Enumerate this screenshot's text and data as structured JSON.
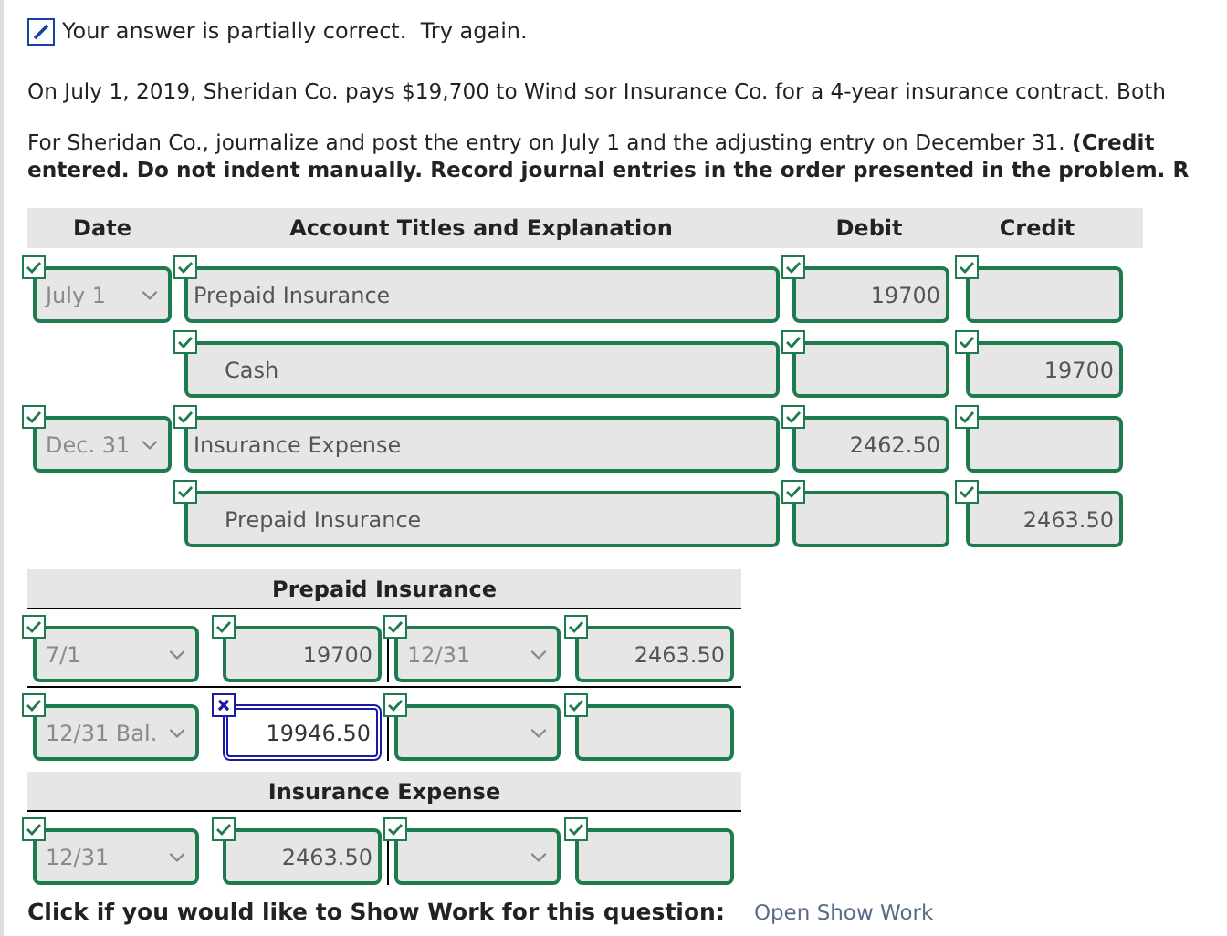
{
  "feedback": {
    "kind": "partial",
    "text": "Your answer is partially correct.  Try again."
  },
  "problem_text": "On July 1, 2019, Sheridan Co. pays $19,700 to Wind sor Insurance Co. for a 4-year insurance contract. Both",
  "instruction_lines": [
    "For Sheridan Co., journalize and post the entry on July 1 and the adjusting entry on December 31. **(Credit**",
    "**entered. Do not indent manually. Record journal entries in the order presented in the problem. R**"
  ],
  "journal": {
    "columns": [
      "Date",
      "Account Titles and Explanation",
      "Debit",
      "Credit"
    ],
    "rows": [
      {
        "date": {
          "kind": "select",
          "value": "July 1",
          "correct": true
        },
        "account": {
          "kind": "text",
          "value": "Prepaid Insurance",
          "correct": true,
          "indented": false
        },
        "debit": {
          "kind": "text",
          "value": "19700",
          "correct": true
        },
        "credit": {
          "kind": "text",
          "correct": true
        }
      },
      {
        "account": {
          "kind": "text",
          "value": "Cash",
          "correct": true,
          "indented": true
        },
        "debit": {
          "kind": "text",
          "correct": true
        },
        "credit": {
          "kind": "text",
          "value": "19700",
          "correct": true
        }
      },
      {
        "date": {
          "kind": "select",
          "value": "Dec. 31",
          "correct": true
        },
        "account": {
          "kind": "text",
          "value": "Insurance Expense",
          "correct": true,
          "indented": false
        },
        "debit": {
          "kind": "text",
          "value": "2462.50",
          "correct": true
        },
        "credit": {
          "kind": "text",
          "correct": true
        }
      },
      {
        "account": {
          "kind": "text",
          "value": "Prepaid Insurance",
          "correct": true,
          "indented": true
        },
        "debit": {
          "kind": "text",
          "correct": true
        },
        "credit": {
          "kind": "text",
          "value": "2463.50",
          "correct": true
        }
      }
    ]
  },
  "t_accounts": [
    {
      "title": "Prepaid Insurance",
      "rows": [
        [
          {
            "kind": "select",
            "value": "7/1",
            "correct": true
          },
          {
            "kind": "text",
            "value": "19700",
            "correct": true
          },
          {
            "kind": "select",
            "value": "12/31",
            "correct": true
          },
          {
            "kind": "text",
            "value": "2463.50",
            "correct": true
          }
        ],
        [
          {
            "kind": "select",
            "value": "12/31 Bal.",
            "correct": true
          },
          {
            "kind": "text",
            "value": "19946.50",
            "correct": false
          },
          {
            "kind": "select",
            "correct": true
          },
          {
            "kind": "text",
            "correct": true
          }
        ]
      ]
    },
    {
      "title": "Insurance Expense",
      "rows": [
        [
          {
            "kind": "select",
            "value": "12/31",
            "correct": true
          },
          {
            "kind": "text",
            "value": "2463.50",
            "correct": true
          },
          {
            "kind": "select",
            "correct": true
          },
          {
            "kind": "text",
            "correct": true
          }
        ]
      ]
    }
  ],
  "show_work": {
    "prompt": "Click if you would like to Show Work for this question:",
    "link": "Open Show Work"
  }
}
